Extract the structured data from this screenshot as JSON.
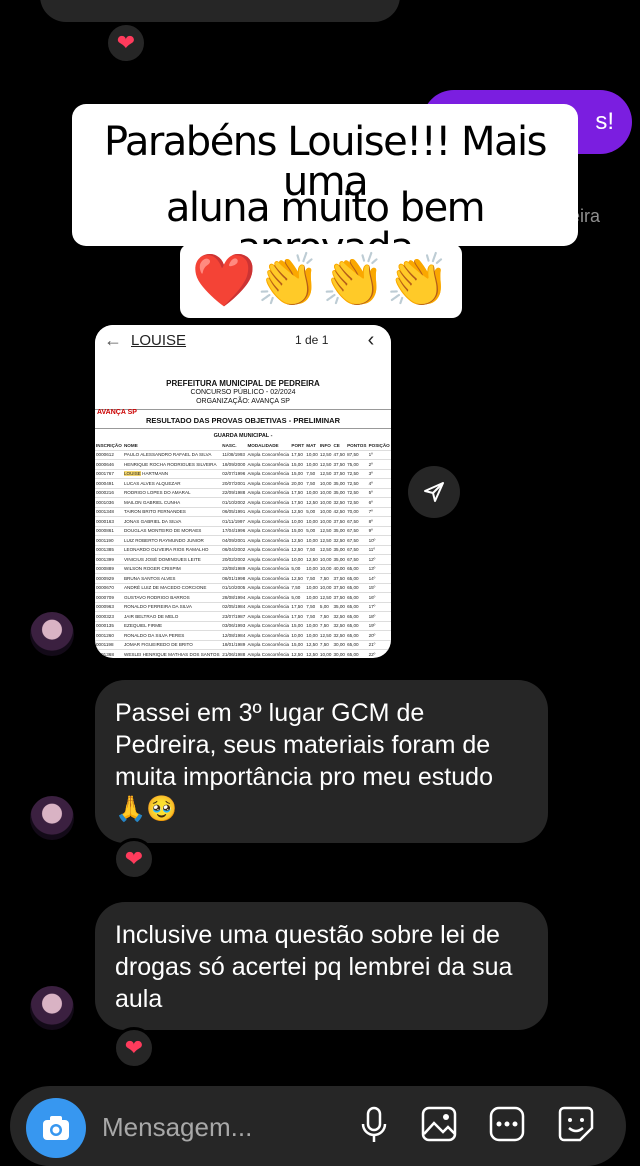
{
  "thread": {
    "overlay_caption_line1": "Parabéns Louise!!! Mais uma",
    "overlay_caption_line2": "aluna muito bem aprovada",
    "overlay_emojis": "❤️👏👏👏",
    "outgoing_visible_text": "s!",
    "side_fragment": "eira"
  },
  "document": {
    "header_name": "LOUISE",
    "page_indicator": "1 de 1",
    "org": "PREFEITURA MUNICIPAL DE PEDREIRA",
    "contest": "CONCURSO PÚBLICO - 02/2024",
    "organizer": "ORGANIZAÇÃO: AVANÇA SP",
    "logo": "AVANÇA SP",
    "title": "RESULTADO DAS PROVAS OBJETIVAS - PRELIMINAR",
    "section": "GUARDA MUNICIPAL -",
    "columns": [
      "INSCRIÇÃO",
      "NOME",
      "NASC.",
      "MODALIDADE",
      "PORT",
      "MAT",
      "INFO",
      "CE",
      "PONTOS",
      "POSIÇÃO"
    ],
    "rows": [
      [
        "0000612",
        "PAULO ALESSANDRO RAFAEL DA SILVA",
        "11/08/1993",
        "Ampla Concorrência",
        "17,50",
        "10,00",
        "12,50",
        "47,50",
        "87,50",
        "1º"
      ],
      [
        "0000646",
        "HENRIQUE ROCHA RODRIGUES SILVEIRA",
        "18/09/2000",
        "Ampla Concorrência",
        "15,00",
        "10,00",
        "12,50",
        "37,50",
        "75,00",
        "2º"
      ],
      [
        "0001767",
        "LOUISE HARTMANN",
        "02/07/1996",
        "Ampla Concorrência",
        "15,00",
        "7,50",
        "12,50",
        "37,50",
        "72,50",
        "3º"
      ],
      [
        "0000491",
        "LUCAS ALVES ALQUEZAR",
        "20/07/2001",
        "Ampla Concorrência",
        "20,00",
        "7,50",
        "10,00",
        "35,00",
        "72,50",
        "4º"
      ],
      [
        "0000216",
        "RODRIGO LOPES DO AMARAL",
        "22/09/1988",
        "Ampla Concorrência",
        "17,50",
        "10,00",
        "10,00",
        "35,00",
        "72,50",
        "5º"
      ],
      [
        "0001036",
        "MAILON GABRIEL CUNHA",
        "01/10/2002",
        "Ampla Concorrência",
        "17,50",
        "12,50",
        "10,00",
        "32,50",
        "72,50",
        "6º"
      ],
      [
        "0001348",
        "TAIRON BRITO FERNANDES",
        "06/05/1991",
        "Ampla Concorrência",
        "12,50",
        "5,00",
        "10,00",
        "42,50",
        "70,00",
        "7º"
      ],
      [
        "0000163",
        "JONAS GABRIEL DA SILVA",
        "01/11/1997",
        "Ampla Concorrência",
        "10,00",
        "10,00",
        "10,00",
        "37,50",
        "67,50",
        "8º"
      ],
      [
        "0000861",
        "DOUGLAS MONTEIRO DE MORAES",
        "17/04/1996",
        "Ampla Concorrência",
        "15,00",
        "5,00",
        "12,50",
        "35,00",
        "67,50",
        "9º"
      ],
      [
        "0001190",
        "LUIZ ROBERTO RAYMUNDO JUNIOR",
        "04/09/2001",
        "Ampla Concorrência",
        "12,50",
        "10,00",
        "12,50",
        "32,50",
        "67,50",
        "10º"
      ],
      [
        "0001385",
        "LEONARDO OLIVEIRA RIOS RAMALHO",
        "06/04/2002",
        "Ampla Concorrência",
        "12,50",
        "7,50",
        "12,50",
        "35,00",
        "67,50",
        "11º"
      ],
      [
        "0001399",
        "VINICIUS JOSÉ DOMINGUES LEITE",
        "20/02/2002",
        "Ampla Concorrência",
        "10,00",
        "12,50",
        "10,00",
        "35,00",
        "67,50",
        "12º"
      ],
      [
        "0000889",
        "WILSON ROGER CRISPIM",
        "22/08/1989",
        "Ampla Concorrência",
        "5,00",
        "10,00",
        "10,00",
        "40,00",
        "65,00",
        "13º"
      ],
      [
        "0000929",
        "BRUNA SANTOS ALVES",
        "06/01/1998",
        "Ampla Concorrência",
        "12,50",
        "7,50",
        "7,50",
        "37,50",
        "65,00",
        "14º"
      ],
      [
        "0000670",
        "ANDRÉ LUIZ DE MACEDO CORCIONE",
        "01/10/2005",
        "Ampla Concorrência",
        "7,50",
        "10,00",
        "10,00",
        "37,50",
        "65,00",
        "15º"
      ],
      [
        "0000709",
        "GUSTAVO RODRIGO BARROS",
        "28/08/1994",
        "Ampla Concorrência",
        "5,00",
        "10,00",
        "12,50",
        "37,50",
        "65,00",
        "16º"
      ],
      [
        "0000963",
        "RONALDO FERREIRA DA SILVA",
        "02/05/1984",
        "Ampla Concorrência",
        "17,50",
        "7,50",
        "5,00",
        "35,00",
        "65,00",
        "17º"
      ],
      [
        "0000323",
        "JAIR BELTRAO DE MELO",
        "23/07/1987",
        "Ampla Concorrência",
        "17,50",
        "7,50",
        "7,50",
        "32,50",
        "65,00",
        "18º"
      ],
      [
        "0000135",
        "EZEQUIEL FIRME",
        "03/06/1993",
        "Ampla Concorrência",
        "15,00",
        "10,00",
        "7,50",
        "32,50",
        "65,00",
        "19º"
      ],
      [
        "0001260",
        "RONALDO DA SILVA PERES",
        "12/08/1984",
        "Ampla Concorrência",
        "10,00",
        "10,00",
        "12,50",
        "32,50",
        "65,00",
        "20º"
      ],
      [
        "0001198",
        "JOMAR FIGUEIREDO DE BRITO",
        "18/01/1989",
        "Ampla Concorrência",
        "15,00",
        "12,50",
        "7,50",
        "30,00",
        "65,00",
        "21º"
      ],
      [
        "0001368",
        "WESLEI HENRIQUE MATHIAS DOS SANTOS",
        "21/06/1988",
        "Ampla Concorrência",
        "12,50",
        "12,50",
        "10,00",
        "30,00",
        "65,00",
        "22º"
      ],
      [
        "0000251",
        "LIDIA NEGRETTI",
        "05/04/1999",
        "Ampla Concorrência",
        "10,00",
        "12,50",
        "10,00",
        "30,00",
        "62,50",
        "23º"
      ]
    ],
    "highlight_name": "LOUISE"
  },
  "messages": [
    {
      "text": "Passei em 3º lugar GCM de Pedreira, seus materiais foram de muita importância pro meu estudo 🙏🥹",
      "reaction": "❤"
    },
    {
      "text": "Inclusive uma questão sobre lei de drogas só acertei pq lembrei da sua aula",
      "reaction": "❤"
    }
  ],
  "top_reaction": "❤",
  "composer": {
    "placeholder": "Mensagem..."
  },
  "colors": {
    "accent_blue": "#3797f0",
    "outgoing_purple": "#7b1ee0",
    "bubble_gray": "#262626",
    "reaction_red": "#ff3b5c"
  },
  "icons": [
    "camera-icon",
    "microphone-icon",
    "gallery-icon",
    "more-icon",
    "sticker-icon",
    "send-icon",
    "heart-icon"
  ]
}
